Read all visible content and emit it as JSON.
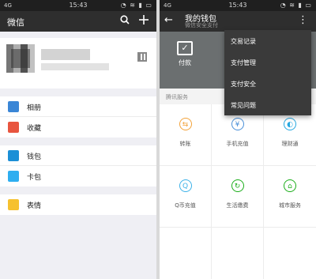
{
  "left": {
    "statusbar": {
      "network": "4G",
      "time": "15:43",
      "icons": "◔ ≋ ▮ ▭"
    },
    "appbar": {
      "title": "微信",
      "search_icon": "search-icon",
      "add_icon": "plus-icon"
    },
    "menu_groups": [
      [
        {
          "label": "相册",
          "icon": "photo-icon",
          "color": "#3a86d6"
        },
        {
          "label": "收藏",
          "icon": "cube-icon",
          "color": "#e8553f"
        }
      ],
      [
        {
          "label": "钱包",
          "icon": "wallet-icon",
          "color": "#1c8fd6"
        },
        {
          "label": "卡包",
          "icon": "card-icon",
          "color": "#2eaef0"
        }
      ],
      [
        {
          "label": "表情",
          "icon": "emoji-icon",
          "color": "#f6c12f"
        }
      ]
    ]
  },
  "right": {
    "statusbar": {
      "network": "4G",
      "time": "15:43",
      "icons": "◔ ≋ ▮ ▭"
    },
    "header": {
      "title": "我的钱包",
      "subtitle": "微信安全支付"
    },
    "pay": {
      "label": "付款"
    },
    "section_label": "腾讯服务",
    "services": [
      {
        "label": "转账",
        "icon": "transfer-icon",
        "color": "#f3a33a",
        "glyph": "⇆"
      },
      {
        "label": "手机充值",
        "icon": "phone-topup-icon",
        "color": "#4a90d9",
        "glyph": "¥"
      },
      {
        "label": "理财通",
        "icon": "wealth-icon",
        "color": "#26a8e0",
        "glyph": "◐"
      },
      {
        "label": "Q币充值",
        "icon": "qcoin-icon",
        "color": "#3cb1e8",
        "glyph": "Q"
      },
      {
        "label": "生活缴费",
        "icon": "utility-icon",
        "color": "#1aad19",
        "glyph": "↻"
      },
      {
        "label": "城市服务",
        "icon": "city-icon",
        "color": "#1aad19",
        "glyph": "⌂"
      }
    ],
    "dropdown": [
      "交易记录",
      "支付管理",
      "支付安全",
      "常见问题"
    ]
  }
}
